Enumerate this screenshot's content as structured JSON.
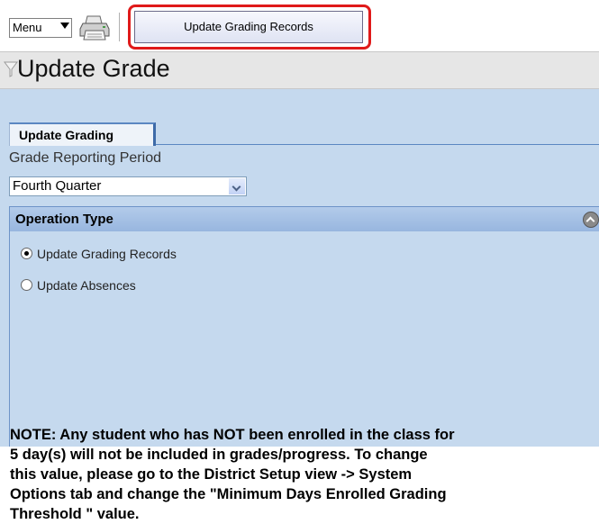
{
  "toolbar": {
    "menu_label": "Menu",
    "print_icon": "printer-icon",
    "update_button_label": "Update Grading Records",
    "highlight_color": "#e01a1a"
  },
  "header": {
    "title": "Update Grade",
    "filter_icon": "funnel-icon"
  },
  "tabs": [
    {
      "label": "Update Grading"
    }
  ],
  "form": {
    "period_label": "Grade Reporting Period",
    "period_value": "Fourth Quarter"
  },
  "operation": {
    "header": "Operation Type",
    "options": [
      {
        "label": "Update Grading Records",
        "selected": true
      },
      {
        "label": "Update Absences",
        "selected": false
      }
    ]
  },
  "note": {
    "lines": [
      "NOTE: Any student who has NOT been enrolled in the class for",
      "5 day(s) will not be included in grades/progress. To change",
      "this value, please go to the District Setup view -> System",
      "Options tab and change the \"Minimum Days Enrolled Grading",
      "Threshold \" value."
    ]
  },
  "colors": {
    "panel_bg": "#c5d9ee",
    "section_header": "#a7c2e6",
    "title_bar": "#e6e6e6"
  }
}
